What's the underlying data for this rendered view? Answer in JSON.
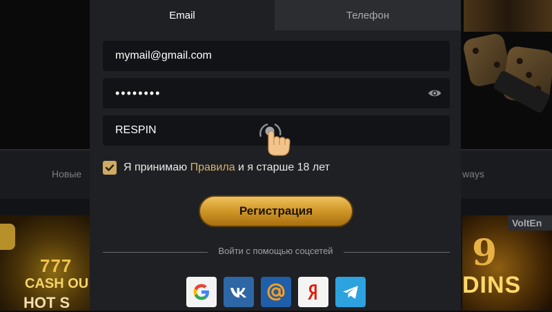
{
  "tabs": [
    {
      "label": "Email",
      "active": true
    },
    {
      "label": "Телефон",
      "active": false
    }
  ],
  "form": {
    "email_value": "mymail@gmail.com",
    "password_value": "••••••••",
    "promo_value": "RESPIN",
    "agree_prefix": "Я принимаю ",
    "agree_link": "Правила",
    "agree_suffix": " и я старше 18 лет",
    "agree_checked": true,
    "register_label": "Регистрация"
  },
  "social": {
    "label": "Войти с помощью соцсетей",
    "providers": [
      {
        "icon": "google-icon"
      },
      {
        "icon": "vk-icon"
      },
      {
        "icon": "mail-ru-icon"
      },
      {
        "icon": "yandex-icon"
      },
      {
        "icon": "telegram-icon"
      }
    ]
  },
  "background": {
    "nav_items": [
      "Новые",
      "ways"
    ],
    "right_badge": "VoltEn",
    "left_game_text": [
      "777",
      "CASH OU",
      "HOT S"
    ],
    "right_game_text": [
      "9",
      "DINS"
    ]
  },
  "colors": {
    "accent_gold": "#d8b36b",
    "modal_bg": "#1f2023",
    "field_bg": "#121316",
    "telegram": "#2ca2df",
    "vk": "#2e67a5"
  }
}
